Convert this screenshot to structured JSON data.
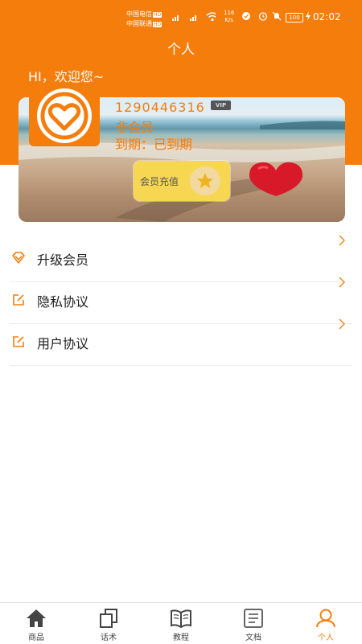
{
  "status_bar": {
    "carrier_1": "中国电信",
    "carrier_2": "中国联通",
    "hd": "HD",
    "signal_1": "4G",
    "signal_2": "4G",
    "speed_value": "116",
    "speed_unit": "K/s",
    "battery": "100",
    "time": "02:02"
  },
  "header": {
    "title": "个人"
  },
  "greeting": "HI，欢迎您~",
  "profile": {
    "account": "1290446316",
    "vip_badge": "VIP",
    "membership_status": "非会员",
    "expiry": "到期：已到期",
    "recharge_label": "会员充值"
  },
  "menu": [
    {
      "label": "升级会员",
      "icon": "diamond-icon"
    },
    {
      "label": "隐私协议",
      "icon": "edit-icon"
    },
    {
      "label": "用户协议",
      "icon": "edit-icon"
    }
  ],
  "bottom_nav": [
    {
      "label": "商品",
      "icon": "home-icon",
      "active": false
    },
    {
      "label": "话术",
      "icon": "copy-icon",
      "active": false
    },
    {
      "label": "教程",
      "icon": "book-icon",
      "active": false
    },
    {
      "label": "文档",
      "icon": "document-icon",
      "active": false
    },
    {
      "label": "个人",
      "icon": "person-icon",
      "active": true
    }
  ],
  "colors": {
    "accent": "#f57d0c",
    "inactive": "#444444"
  }
}
